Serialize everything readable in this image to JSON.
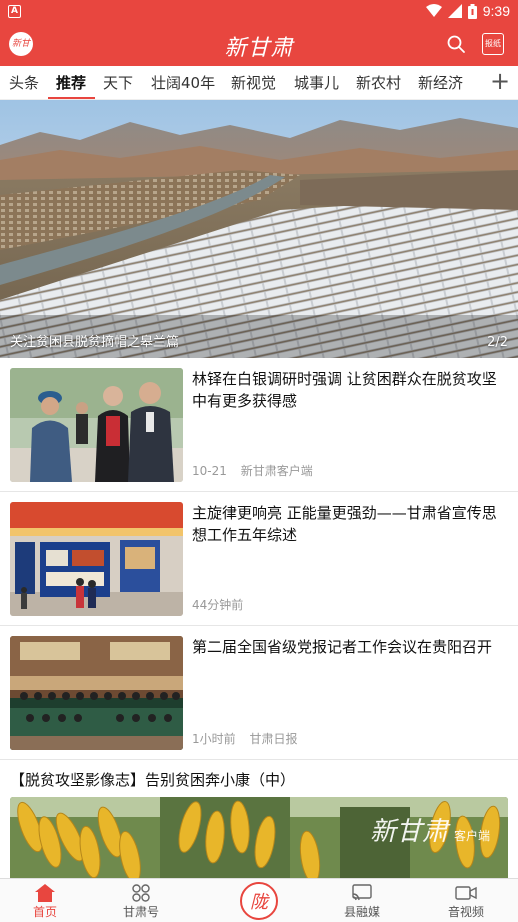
{
  "status": {
    "time": "9:39",
    "warn_icon": "warning-icon",
    "wifi_icon": "wifi-icon",
    "signal_icon": "signal-icon",
    "battery_icon": "battery-icon"
  },
  "app": {
    "brand": "新甘肃",
    "logo_text": "新甘肃",
    "paper_label": "报纸",
    "accent": "#e8463f"
  },
  "tabs": [
    {
      "label": "头条"
    },
    {
      "label": "推荐"
    },
    {
      "label": "天下"
    },
    {
      "label": "壮阔40年"
    },
    {
      "label": "新视觉"
    },
    {
      "label": "城事儿"
    },
    {
      "label": "新农村"
    },
    {
      "label": "新经济"
    }
  ],
  "active_tab": "推荐",
  "hero": {
    "caption": "关注贫困县脱贫摘帽之皋兰篇",
    "counter": "2/2"
  },
  "articles": [
    {
      "title": "林铎在白银调研时强调 让贫困群众在脱贫攻坚中有更多获得感",
      "date": "10-21",
      "source": "新甘肃客户端"
    },
    {
      "title": "主旋律更响亮 正能量更强劲——甘肃省宣传思想工作五年综述",
      "date": "44分钟前",
      "source": ""
    },
    {
      "title": "第二届全国省级党报记者工作会议在贵阳召开",
      "date": "1小时前",
      "source": "甘肃日报"
    }
  ],
  "special": {
    "title": "【脱贫攻坚影像志】告别贫困奔小康（中）",
    "watermark": "新甘肃",
    "watermark_sub": "客户端"
  },
  "bottom_nav": [
    {
      "label": "首页",
      "icon": "home-icon"
    },
    {
      "label": "甘肃号",
      "icon": "grid-icon"
    },
    {
      "label": "陇",
      "icon": "center-logo-icon"
    },
    {
      "label": "县融媒",
      "icon": "cast-icon"
    },
    {
      "label": "音视频",
      "icon": "video-icon"
    }
  ]
}
